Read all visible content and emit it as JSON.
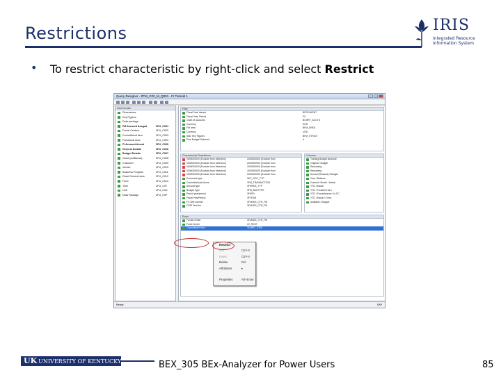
{
  "slide": {
    "title": "Restrictions",
    "bullet": "•",
    "bullet_text": "To restrict characteristic by right-click and select ",
    "bullet_bold": "Restrict",
    "footer_text": "BEX_305 BEx-Analyzer for Power Users",
    "page_number": "85",
    "footer_logo_uk": "UK",
    "footer_logo_text": "UNIVERSITY OF KENTUCKY"
  },
  "logo": {
    "brand": "IRIS",
    "subtitle": "Integrated Resource Information System"
  },
  "window": {
    "title": "Query Designer - ZFM_C02_M_Q001 - FI Tutorial 1",
    "left_header": "InfoProvider",
    "left_rows": [
      {
        "label": "Dimensions",
        "code": "",
        "bold": false
      },
      {
        "label": "Key Figures",
        "code": "",
        "bold": false
      },
      {
        "label": "Data package",
        "code": "",
        "bold": false
      },
      {
        "label": "FM Account Assgmt",
        "code": "ZFU_C001",
        "bold": true
      },
      {
        "label": "Funds Centers",
        "code": "ZFU_C002",
        "bold": false
      },
      {
        "label": "Commitment item",
        "code": "ZFU_C003",
        "bold": false
      },
      {
        "label": "Functional area",
        "code": "ZFU_C004",
        "bold": false
      },
      {
        "label": "FI Account Assmt",
        "code": "ZFU_C005",
        "bold": true
      },
      {
        "label": "General Details",
        "code": "ZFU_C006",
        "bold": true
      },
      {
        "label": "Budget Details",
        "code": "ZFU_C007",
        "bold": true
      },
      {
        "label": "Grant (additional)",
        "code": "ZFU_C008",
        "bold": false
      },
      {
        "label": "Customer",
        "code": "ZFU_C009",
        "bold": false
      },
      {
        "label": "Vendor",
        "code": "ZFU_C010",
        "bold": false
      },
      {
        "label": "Business Program",
        "code": "ZFU_C011",
        "bold": false
      },
      {
        "label": "Grant General view",
        "code": "ZFU_C012",
        "bold": false
      },
      {
        "label": "Fund",
        "code": "ZFU_C013",
        "bold": false
      },
      {
        "label": "Time",
        "code": "ZFU_C0T",
        "bold": false
      },
      {
        "label": "Unit",
        "code": "ZFU_C0U",
        "bold": false
      },
      {
        "label": "Data Package",
        "code": "ZFU_C0P",
        "bold": false
      }
    ],
    "filter_header": "Filter",
    "filter_rows": [
      {
        "label": "Fiscal Year Variant",
        "value": "BFSCVARNT"
      },
      {
        "label": "Fiscal Year, Period",
        "value": "FC"
      },
      {
        "label": "Chart of accounts",
        "value": "BCHRT_ACCTS"
      },
      {
        "label": "Currency",
        "value": "EUR"
      },
      {
        "label": "FM area",
        "value": "BFM_AREA"
      },
      {
        "label": "Currency",
        "value": "USD"
      },
      {
        "label": "Stat. Key Figures",
        "value": "BFM_STRGS"
      },
      {
        "label": "Post Budget Relevant",
        "value": "#"
      }
    ],
    "char_header": "Characteristic Restrictions",
    "char_rows": [
      {
        "label": "0000000000 (Exclude from Selection)",
        "value": "2000000000 (Exclude from"
      },
      {
        "label": "0000000000 (Exclude from Selection)",
        "value": "2000000000 (Exclude from"
      },
      {
        "label": "0000000000 (Exclude from Selection)",
        "value": "2000000000 (Exclude from"
      },
      {
        "label": "0000000000 (Exclude from Selection)",
        "value": "2000000000 (Exclude from"
      },
      {
        "label": "0000000000 (Exclude from Selection)",
        "value": "2000000000 (Exclude from"
      },
      {
        "label": "Document type",
        "value": "3KC_DOC_TYP"
      },
      {
        "label": "Commit/actuals items",
        "value": "3FM_TRANSACTION"
      },
      {
        "label": "Amount type",
        "value": "3FMFDS_TYP"
      },
      {
        "label": "Budget Type",
        "value": "3FM_BUDTYPE"
      },
      {
        "label": "Period year/period",
        "value": "3FMFY"
      },
      {
        "label": "Fiscal Year/Period",
        "value": "3FYEAR"
      },
      {
        "label": "FC Wrk number",
        "value": "3FUNDS_CTR_FM"
      },
      {
        "label": "FC90 Text fire",
        "value": "3FUNDS_CTR_FM"
      }
    ],
    "col_header": "Columns",
    "col_rows": [
      "Training Budget structure",
      "Original / Budget",
      "Remaining",
      "Remaining",
      "Annual (Revised) / Budget",
      "Year / Balance",
      "Commit / Month / Actual",
      "YTD / Actual",
      "YTD / Fund/min thru",
      "YTD / Encumbrance / to FC",
      "YTD / Actual / 4 thru",
      "Available / Budget"
    ],
    "rows_header": "Rows",
    "rows_rows": [
      {
        "label": "Funds Center",
        "value": "3FUNDS_CTR_FM"
      },
      {
        "label": "Fund Center",
        "value": "22_RCST"
      },
      {
        "label": "Commitment Item",
        "value": "3CMMT_ITEM"
      }
    ],
    "status": "Ready",
    "status_right": "SAP"
  },
  "context_menu": {
    "items": [
      {
        "label": "Restrict",
        "shortcut": "",
        "disabled": false
      },
      {
        "label": "Cut",
        "shortcut": "Ctrl+X",
        "disabled": true
      },
      {
        "label": "Insert",
        "shortcut": "Ctrl+V",
        "disabled": true
      },
      {
        "label": "Delete",
        "shortcut": "Del",
        "disabled": false
      },
      {
        "label": "Attributes",
        "shortcut": "▸",
        "disabled": false
      },
      {
        "label": "",
        "shortcut": "",
        "disabled": false
      },
      {
        "label": "Properties",
        "shortcut": "Alt+Enter",
        "disabled": false
      }
    ]
  },
  "colors": {
    "title_blue": "#1b2f6b",
    "highlight_red": "#c42b2b",
    "selection_blue": "#2f6fd6"
  }
}
